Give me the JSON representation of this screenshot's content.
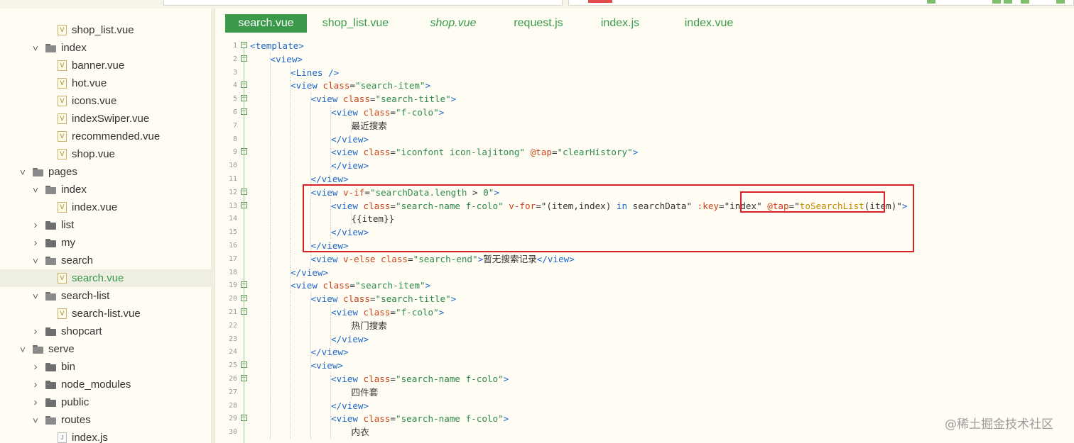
{
  "sidebar": {
    "items": [
      {
        "label": "shop_list.vue",
        "type": "vue",
        "indent": 3
      },
      {
        "label": "index",
        "type": "folder-open",
        "indent": 2
      },
      {
        "label": "banner.vue",
        "type": "vue",
        "indent": 3
      },
      {
        "label": "hot.vue",
        "type": "vue",
        "indent": 3
      },
      {
        "label": "icons.vue",
        "type": "vue",
        "indent": 3
      },
      {
        "label": "indexSwiper.vue",
        "type": "vue",
        "indent": 3
      },
      {
        "label": "recommended.vue",
        "type": "vue",
        "indent": 3
      },
      {
        "label": "shop.vue",
        "type": "vue",
        "indent": 3
      },
      {
        "label": "pages",
        "type": "folder-open",
        "indent": 1
      },
      {
        "label": "index",
        "type": "folder-open",
        "indent": 2
      },
      {
        "label": "index.vue",
        "type": "vue",
        "indent": 3
      },
      {
        "label": "list",
        "type": "folder-closed",
        "indent": 2
      },
      {
        "label": "my",
        "type": "folder-closed",
        "indent": 2
      },
      {
        "label": "search",
        "type": "folder-open",
        "indent": 2
      },
      {
        "label": "search.vue",
        "type": "vue",
        "indent": 3,
        "selected": true
      },
      {
        "label": "search-list",
        "type": "folder-open",
        "indent": 2
      },
      {
        "label": "search-list.vue",
        "type": "vue",
        "indent": 3
      },
      {
        "label": "shopcart",
        "type": "folder-closed",
        "indent": 2
      },
      {
        "label": "serve",
        "type": "folder-open",
        "indent": 1
      },
      {
        "label": "bin",
        "type": "folder-closed",
        "indent": 2
      },
      {
        "label": "node_modules",
        "type": "folder-closed",
        "indent": 2
      },
      {
        "label": "public",
        "type": "folder-closed",
        "indent": 2
      },
      {
        "label": "routes",
        "type": "folder-open",
        "indent": 2
      },
      {
        "label": "index.js",
        "type": "js",
        "indent": 3
      }
    ]
  },
  "tabs": [
    {
      "label": "search.vue",
      "active": true
    },
    {
      "label": "shop_list.vue"
    },
    {
      "label": "shop.vue",
      "italic": true
    },
    {
      "label": "request.js"
    },
    {
      "label": "index.js"
    },
    {
      "label": "index.vue"
    }
  ],
  "code": {
    "lines": [
      {
        "n": "1",
        "fold": true,
        "indent": 0,
        "tokens": [
          [
            "t",
            "<template>"
          ]
        ]
      },
      {
        "n": "2",
        "fold": true,
        "indent": 1,
        "tokens": [
          [
            "t",
            "<view>"
          ]
        ]
      },
      {
        "n": "3",
        "indent": 2,
        "tokens": [
          [
            "t",
            "<Lines />"
          ]
        ]
      },
      {
        "n": "4",
        "fold": true,
        "indent": 2,
        "tokens": [
          [
            "t",
            "<view "
          ],
          [
            "a",
            "class"
          ],
          [
            "p",
            "="
          ],
          [
            "s",
            "\"search-item\""
          ],
          [
            "t",
            ">"
          ]
        ]
      },
      {
        "n": "5",
        "fold": true,
        "indent": 3,
        "tokens": [
          [
            "t",
            "<view "
          ],
          [
            "a",
            "class"
          ],
          [
            "p",
            "="
          ],
          [
            "s",
            "\"search-title\""
          ],
          [
            "t",
            ">"
          ]
        ]
      },
      {
        "n": "6",
        "fold": true,
        "indent": 4,
        "tokens": [
          [
            "t",
            "<view "
          ],
          [
            "a",
            "class"
          ],
          [
            "p",
            "="
          ],
          [
            "s",
            "\"f-colo\""
          ],
          [
            "t",
            ">"
          ]
        ]
      },
      {
        "n": "7",
        "indent": 5,
        "tokens": [
          [
            "p",
            "最近搜索"
          ]
        ]
      },
      {
        "n": "8",
        "indent": 4,
        "tokens": [
          [
            "t",
            "</view>"
          ]
        ]
      },
      {
        "n": "9",
        "fold": true,
        "indent": 4,
        "tokens": [
          [
            "t",
            "<view "
          ],
          [
            "a",
            "class"
          ],
          [
            "p",
            "="
          ],
          [
            "s",
            "\"iconfont icon-lajitong\""
          ],
          [
            "p",
            " "
          ],
          [
            "a",
            "@tap"
          ],
          [
            "p",
            "="
          ],
          [
            "s",
            "\"clearHistory\""
          ],
          [
            "t",
            ">"
          ]
        ]
      },
      {
        "n": "10",
        "indent": 4,
        "tokens": [
          [
            "t",
            "</view>"
          ]
        ]
      },
      {
        "n": "11",
        "indent": 3,
        "tokens": [
          [
            "t",
            "</view>"
          ]
        ]
      },
      {
        "n": "12",
        "fold": true,
        "indent": 3,
        "tokens": [
          [
            "t",
            "<view "
          ],
          [
            "a",
            "v-if"
          ],
          [
            "p",
            "="
          ],
          [
            "s",
            "\"searchData.length "
          ],
          [
            "p",
            ">"
          ],
          [
            "s",
            " 0\""
          ],
          [
            "t",
            ">"
          ]
        ]
      },
      {
        "n": "13",
        "fold": true,
        "indent": 4,
        "tokens": [
          [
            "t",
            "<view "
          ],
          [
            "a",
            "class"
          ],
          [
            "p",
            "="
          ],
          [
            "s",
            "\"search-name f-colo\""
          ],
          [
            "p",
            " "
          ],
          [
            "a",
            "v-for"
          ],
          [
            "p",
            "=\"(item,index) "
          ],
          [
            "kw",
            "in"
          ],
          [
            "p",
            " searchData\" "
          ],
          [
            "a",
            ":key"
          ],
          [
            "p",
            "=\"index\" "
          ],
          [
            "a",
            "@tap"
          ],
          [
            "p",
            "=\""
          ],
          [
            "y",
            "toSearchList"
          ],
          [
            "p",
            "(item)\""
          ],
          [
            "t",
            ">"
          ]
        ]
      },
      {
        "n": "14",
        "indent": 5,
        "tokens": [
          [
            "p",
            "{{item}}"
          ]
        ]
      },
      {
        "n": "15",
        "indent": 4,
        "tokens": [
          [
            "t",
            "</view>"
          ]
        ]
      },
      {
        "n": "16",
        "indent": 3,
        "tokens": [
          [
            "t",
            "</view>"
          ]
        ]
      },
      {
        "n": "17",
        "indent": 3,
        "tokens": [
          [
            "t",
            "<view "
          ],
          [
            "a",
            "v-else"
          ],
          [
            "p",
            " "
          ],
          [
            "a",
            "class"
          ],
          [
            "p",
            "="
          ],
          [
            "s",
            "\"search-end\""
          ],
          [
            "t",
            ">"
          ],
          [
            "p",
            "暂无搜索记录"
          ],
          [
            "t",
            "</view>"
          ]
        ]
      },
      {
        "n": "18",
        "indent": 2,
        "tokens": [
          [
            "t",
            "</view>"
          ]
        ]
      },
      {
        "n": "19",
        "fold": true,
        "indent": 2,
        "tokens": [
          [
            "t",
            "<view "
          ],
          [
            "a",
            "class"
          ],
          [
            "p",
            "="
          ],
          [
            "s",
            "\"search-item\""
          ],
          [
            "t",
            ">"
          ]
        ]
      },
      {
        "n": "20",
        "fold": true,
        "indent": 3,
        "tokens": [
          [
            "t",
            "<view "
          ],
          [
            "a",
            "class"
          ],
          [
            "p",
            "="
          ],
          [
            "s",
            "\"search-title\""
          ],
          [
            "t",
            ">"
          ]
        ]
      },
      {
        "n": "21",
        "fold": true,
        "indent": 4,
        "tokens": [
          [
            "t",
            "<view "
          ],
          [
            "a",
            "class"
          ],
          [
            "p",
            "="
          ],
          [
            "s",
            "\"f-colo\""
          ],
          [
            "t",
            ">"
          ]
        ]
      },
      {
        "n": "22",
        "indent": 5,
        "tokens": [
          [
            "p",
            "热门搜索"
          ]
        ]
      },
      {
        "n": "23",
        "indent": 4,
        "tokens": [
          [
            "t",
            "</view>"
          ]
        ]
      },
      {
        "n": "24",
        "indent": 3,
        "tokens": [
          [
            "t",
            "</view>"
          ]
        ]
      },
      {
        "n": "25",
        "fold": true,
        "indent": 3,
        "tokens": [
          [
            "t",
            "<view>"
          ]
        ]
      },
      {
        "n": "26",
        "fold": true,
        "indent": 4,
        "tokens": [
          [
            "t",
            "<view "
          ],
          [
            "a",
            "class"
          ],
          [
            "p",
            "="
          ],
          [
            "s",
            "\"search-name f-colo\""
          ],
          [
            "t",
            ">"
          ]
        ]
      },
      {
        "n": "27",
        "indent": 5,
        "tokens": [
          [
            "p",
            "四件套"
          ]
        ]
      },
      {
        "n": "28",
        "indent": 4,
        "tokens": [
          [
            "t",
            "</view>"
          ]
        ]
      },
      {
        "n": "29",
        "fold": true,
        "indent": 4,
        "tokens": [
          [
            "t",
            "<view "
          ],
          [
            "a",
            "class"
          ],
          [
            "p",
            "="
          ],
          [
            "s",
            "\"search-name f-colo\""
          ],
          [
            "t",
            ">"
          ]
        ]
      },
      {
        "n": "30",
        "indent": 5,
        "tokens": [
          [
            "p",
            "内衣"
          ]
        ]
      }
    ]
  },
  "watermark": "@稀土掘金技术社区"
}
